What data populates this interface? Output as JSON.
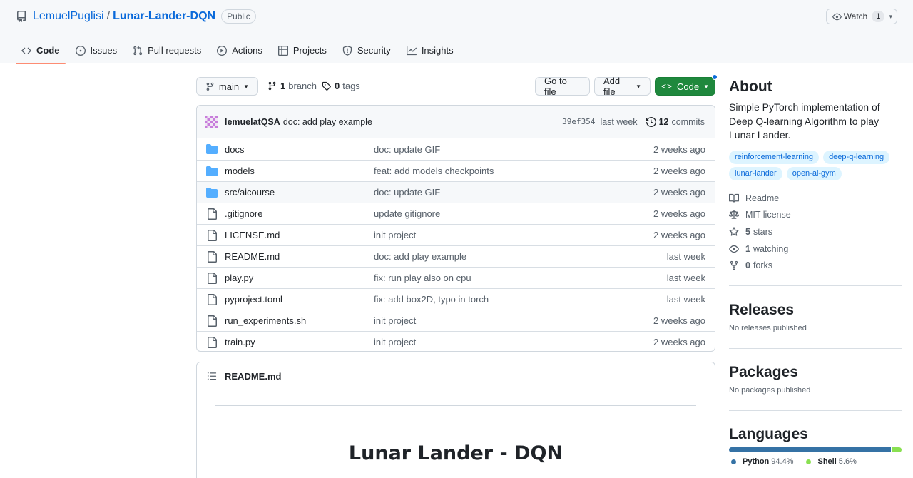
{
  "repo": {
    "owner": "LemuelPuglisi",
    "separator": "/",
    "name": "Lunar-Lander-DQN",
    "visibility": "Public",
    "watch_label": "Watch",
    "watch_count": "1"
  },
  "nav": {
    "tabs": [
      {
        "label": "Code",
        "icon": "code-icon",
        "active": true
      },
      {
        "label": "Issues",
        "icon": "issue-icon"
      },
      {
        "label": "Pull requests",
        "icon": "pull-request-icon"
      },
      {
        "label": "Actions",
        "icon": "play-icon"
      },
      {
        "label": "Projects",
        "icon": "table-icon"
      },
      {
        "label": "Security",
        "icon": "shield-icon"
      },
      {
        "label": "Insights",
        "icon": "graph-icon"
      }
    ]
  },
  "toolbar": {
    "branch": "main",
    "branch_count": "1",
    "branch_label": "branch",
    "tag_count": "0",
    "tag_label": "tags",
    "go_to_file": "Go to file",
    "add_file": "Add file",
    "code": "Code"
  },
  "latest_commit": {
    "author": "lemuelatQSA",
    "message": "doc: add play example",
    "sha": "39ef354",
    "when": "last week",
    "commit_count": "12",
    "commits_label": "commits"
  },
  "files": [
    {
      "type": "dir",
      "name": "docs",
      "commit": "doc: update GIF",
      "age": "2 weeks ago"
    },
    {
      "type": "dir",
      "name": "models",
      "commit": "feat: add models checkpoints",
      "age": "2 weeks ago"
    },
    {
      "type": "dir",
      "name": "src/aicourse",
      "commit": "doc: update GIF",
      "age": "2 weeks ago"
    },
    {
      "type": "file",
      "name": ".gitignore",
      "commit": "update gitignore",
      "age": "2 weeks ago"
    },
    {
      "type": "file",
      "name": "LICENSE.md",
      "commit": "init project",
      "age": "2 weeks ago"
    },
    {
      "type": "file",
      "name": "README.md",
      "commit": "doc: add play example",
      "age": "last week"
    },
    {
      "type": "file",
      "name": "play.py",
      "commit": "fix: run play also on cpu",
      "age": "last week"
    },
    {
      "type": "file",
      "name": "pyproject.toml",
      "commit": "fix: add box2D, typo in torch",
      "age": "last week"
    },
    {
      "type": "file",
      "name": "run_experiments.sh",
      "commit": "init project",
      "age": "2 weeks ago"
    },
    {
      "type": "file",
      "name": "train.py",
      "commit": "init project",
      "age": "2 weeks ago"
    }
  ],
  "readme": {
    "filename": "README.md",
    "title": "Lunar Lander - DQN"
  },
  "about": {
    "title": "About",
    "description": "Simple PyTorch implementation of Deep Q-learning Algorithm to play Lunar Lander.",
    "topics": [
      "reinforcement-learning",
      "deep-q-learning",
      "lunar-lander",
      "open-ai-gym"
    ],
    "readme": "Readme",
    "license": "MIT license",
    "stars_count": "5",
    "stars_label": "stars",
    "watching_count": "1",
    "watching_label": "watching",
    "forks_count": "0",
    "forks_label": "forks"
  },
  "releases": {
    "title": "Releases",
    "text": "No releases published"
  },
  "packages": {
    "title": "Packages",
    "text": "No packages published"
  },
  "languages": {
    "title": "Languages",
    "items": [
      {
        "name": "Python",
        "percent": "94.4%",
        "value": 94.4,
        "color": "#3572a5"
      },
      {
        "name": "Shell",
        "percent": "5.6%",
        "value": 5.6,
        "color": "#89e051"
      }
    ]
  },
  "colors": {
    "link": "#0969da",
    "primary_button": "#1f883d",
    "active_tab_underline": "#fd8c73",
    "folder": "#54aeff"
  }
}
